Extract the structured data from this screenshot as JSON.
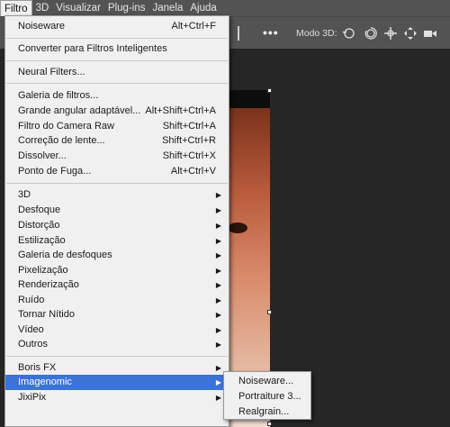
{
  "menubar": {
    "items": [
      "Filtro",
      "3D",
      "Visualizar",
      "Plug-ins",
      "Janela",
      "Ajuda"
    ],
    "active": "Filtro"
  },
  "options_bar": {
    "more_glyph": "•••",
    "mode_3d_label": "Modo 3D:",
    "icons": [
      "orbit-icon",
      "roll-icon",
      "pan-icon",
      "slide-icon",
      "camera-icon"
    ]
  },
  "filter_menu": {
    "noiseware": {
      "label": "Noiseware",
      "shortcut": "Alt+Ctrl+F"
    },
    "convert": {
      "label": "Converter para Filtros Inteligentes"
    },
    "neural": {
      "label": "Neural Filters..."
    },
    "gallery": {
      "label": "Galeria de filtros..."
    },
    "wide_angle": {
      "label": "Grande angular adaptável...",
      "shortcut": "Alt+Shift+Ctrl+A"
    },
    "camera_raw": {
      "label": "Filtro do Camera Raw",
      "shortcut": "Shift+Ctrl+A"
    },
    "lens": {
      "label": "Correção de lente...",
      "shortcut": "Shift+Ctrl+R"
    },
    "liquify": {
      "label": "Dissolver...",
      "shortcut": "Shift+Ctrl+X"
    },
    "vanishing": {
      "label": "Ponto de Fuga...",
      "shortcut": "Alt+Ctrl+V"
    },
    "sub_3d": "3D",
    "blur": "Desfoque",
    "distort": "Distorção",
    "stylize": "Estilização",
    "blur_gallery": "Galeria de desfoques",
    "pixelate": "Pixelização",
    "render": "Renderização",
    "noise": "Ruído",
    "sharpen": "Tornar Nítido",
    "video": "Vídeo",
    "other": "Outros",
    "boris": "Boris FX",
    "imagenomic": "Imagenomic",
    "jixipix": "JixiPix"
  },
  "imagenomic_submenu": {
    "items": [
      "Noiseware...",
      "Portraiture 3...",
      "Realgrain..."
    ]
  },
  "colors": {
    "highlight": "#3b73d6",
    "menu_bg": "#f0f0f0",
    "chrome": "#535353"
  }
}
